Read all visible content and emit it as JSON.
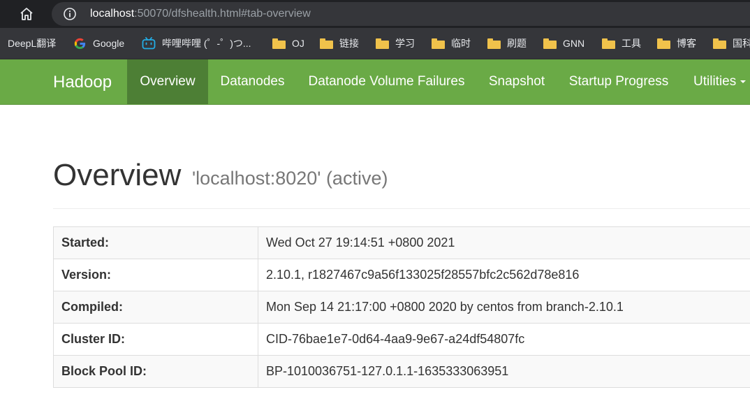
{
  "browser": {
    "url_host": "localhost",
    "url_rest": ":50070/dfshealth.html#tab-overview",
    "icons": {
      "home": "home-icon",
      "info": "info-icon"
    }
  },
  "bookmarks": [
    {
      "label": "DeepL翻译",
      "icon": "none"
    },
    {
      "label": "Google",
      "icon": "google-icon"
    },
    {
      "label": "哔哩哔哩 (゜-゜)つ...",
      "icon": "bilibili-icon"
    },
    {
      "label": "OJ",
      "icon": "folder-icon"
    },
    {
      "label": "链接",
      "icon": "folder-icon"
    },
    {
      "label": "学习",
      "icon": "folder-icon"
    },
    {
      "label": "临时",
      "icon": "folder-icon"
    },
    {
      "label": "刷题",
      "icon": "folder-icon"
    },
    {
      "label": "GNN",
      "icon": "folder-icon"
    },
    {
      "label": "工具",
      "icon": "folder-icon"
    },
    {
      "label": "博客",
      "icon": "folder-icon"
    },
    {
      "label": "国科",
      "icon": "folder-icon"
    }
  ],
  "navbar": {
    "brand": "Hadoop",
    "items": [
      {
        "label": "Overview",
        "active": true
      },
      {
        "label": "Datanodes",
        "active": false
      },
      {
        "label": "Datanode Volume Failures",
        "active": false
      },
      {
        "label": "Snapshot",
        "active": false
      },
      {
        "label": "Startup Progress",
        "active": false
      },
      {
        "label": "Utilities",
        "active": false
      }
    ],
    "colors": {
      "background": "#6aaa46",
      "active": "#4d7f35"
    }
  },
  "page": {
    "title": "Overview",
    "subtitle": "'localhost:8020' (active)"
  },
  "info": {
    "rows": [
      {
        "label": "Started:",
        "value": "Wed Oct 27 19:14:51 +0800 2021"
      },
      {
        "label": "Version:",
        "value": "2.10.1, r1827467c9a56f133025f28557bfc2c562d78e816"
      },
      {
        "label": "Compiled:",
        "value": "Mon Sep 14 21:17:00 +0800 2020 by centos from branch-2.10.1"
      },
      {
        "label": "Cluster ID:",
        "value": "CID-76bae1e7-0d64-4aa9-9e67-a24df54807fc"
      },
      {
        "label": "Block Pool ID:",
        "value": "BP-1010036751-127.0.1.1-1635333063951"
      }
    ]
  }
}
